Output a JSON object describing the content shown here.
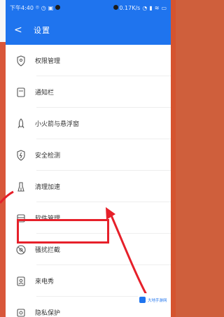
{
  "status_bar": {
    "time": "下午4:40",
    "left_icons": [
      "location-icon",
      "alarm-icon",
      "notification-icon"
    ],
    "speed": "0.17K/s",
    "right_icons": [
      "alarm-clock-icon",
      "signal-icon",
      "wifi-icon",
      "battery-icon"
    ]
  },
  "header": {
    "back_label": "<",
    "title": "设置"
  },
  "settings": {
    "items": [
      {
        "label": "权限管理",
        "icon": "permission-icon"
      },
      {
        "label": "通知栏",
        "icon": "notification-bar-icon"
      },
      {
        "label": "小火箭与悬浮窗",
        "icon": "rocket-icon"
      },
      {
        "label": "安全检测",
        "icon": "security-check-icon"
      },
      {
        "label": "清理加速",
        "icon": "cleanup-icon"
      },
      {
        "label": "软件管理",
        "icon": "software-icon"
      },
      {
        "label": "骚扰拦截",
        "icon": "harassment-block-icon"
      },
      {
        "label": "来电秀",
        "icon": "caller-show-icon"
      },
      {
        "label": "隐私保护",
        "icon": "privacy-icon"
      }
    ]
  },
  "annotation": {
    "highlight_color": "#e6202a",
    "highlighted_item": "清理加速"
  },
  "watermark": {
    "text": "大地手游网"
  },
  "colors": {
    "primary": "#1f74ee",
    "background": "#ffffff",
    "accent": "#e6202a"
  }
}
